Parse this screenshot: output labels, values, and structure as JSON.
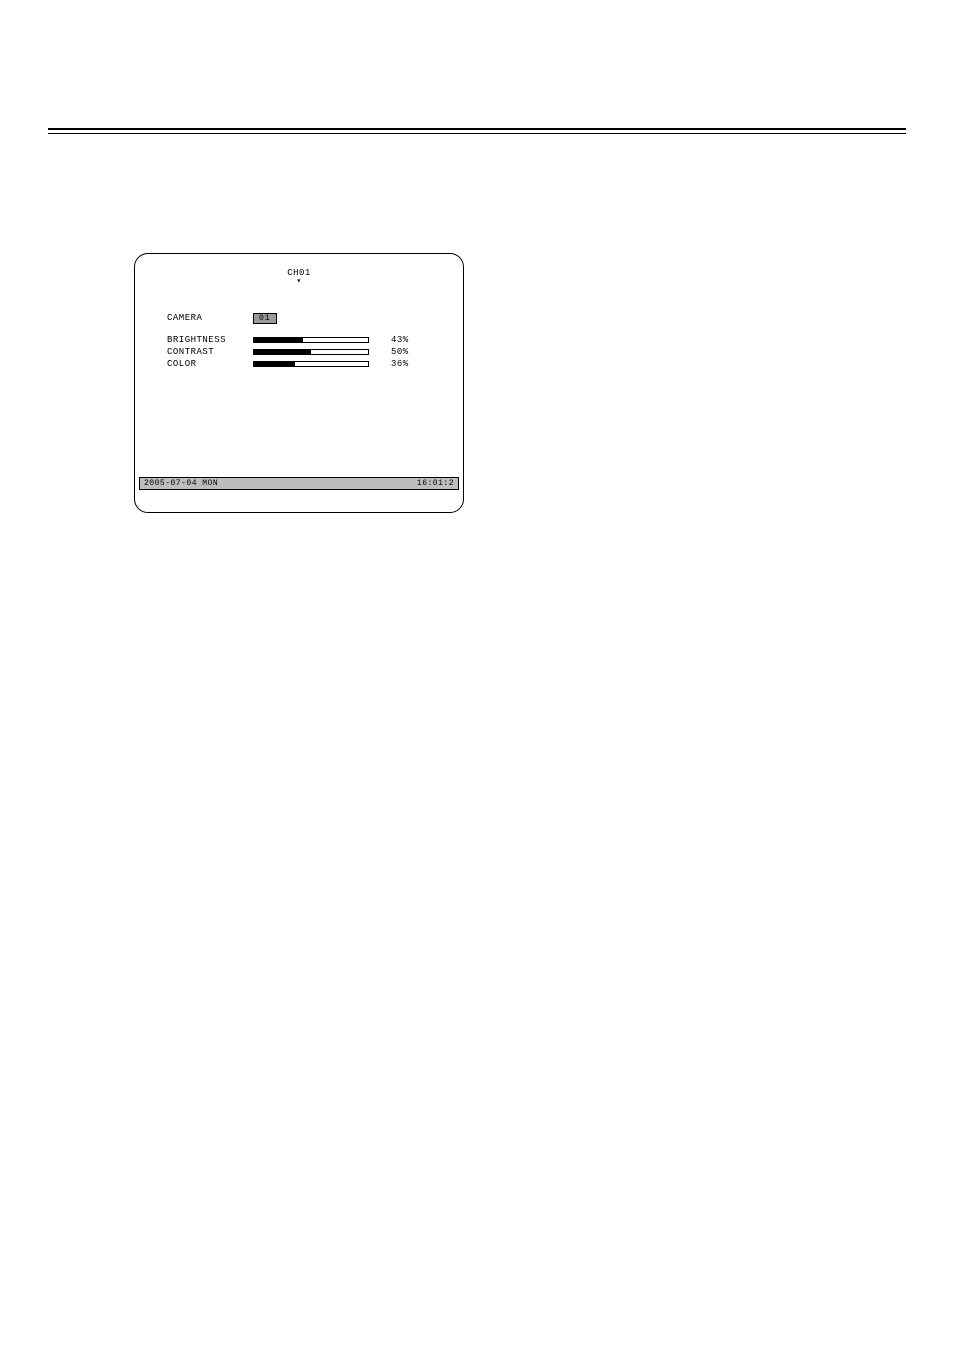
{
  "channel_title": "CH01",
  "camera": {
    "label": "CAMERA",
    "value": "01"
  },
  "sliders": [
    {
      "label": "BRIGHTNESS",
      "percent": 43,
      "display": "43%"
    },
    {
      "label": "CONTRAST",
      "percent": 50,
      "display": "50%"
    },
    {
      "label": "COLOR",
      "percent": 36,
      "display": "36%"
    }
  ],
  "status": {
    "date": "2005-07-04 MON",
    "time": "16:01:2"
  }
}
